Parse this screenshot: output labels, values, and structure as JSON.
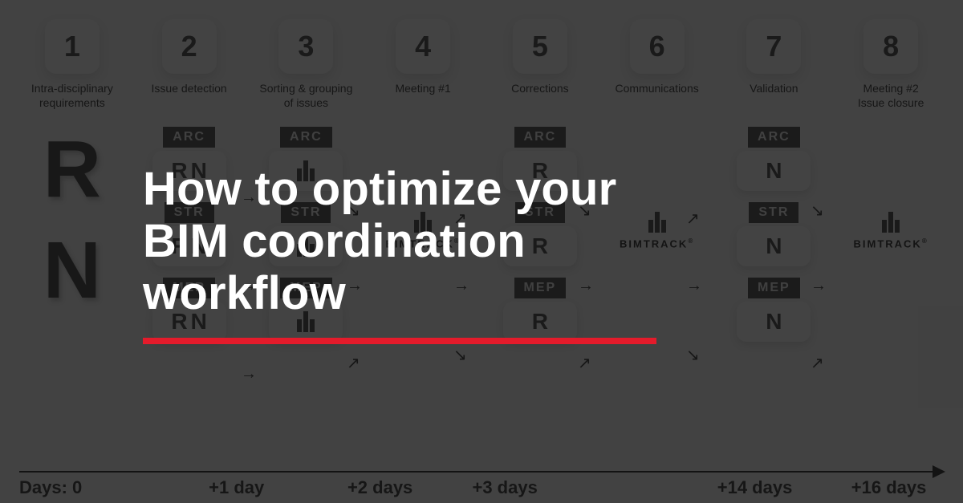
{
  "headline": "How to optimize your\nBIM coordination\nworkflow",
  "accent_color": "#e41b2b",
  "brand": "BIMTRACK",
  "steps": [
    {
      "n": "1",
      "label": "Intra-disciplinary\nrequirements"
    },
    {
      "n": "2",
      "label": "Issue detection"
    },
    {
      "n": "3",
      "label": "Sorting & grouping\nof issues"
    },
    {
      "n": "4",
      "label": "Meeting #1"
    },
    {
      "n": "5",
      "label": "Corrections"
    },
    {
      "n": "6",
      "label": "Communications"
    },
    {
      "n": "7",
      "label": "Validation"
    },
    {
      "n": "8",
      "label": "Meeting #2\nIssue closure"
    }
  ],
  "disciplines": [
    "ARC",
    "STR",
    "MEP"
  ],
  "icons": {
    "R_letter": "R",
    "N_letter": "N"
  },
  "timeline": {
    "axis_label": "Days:",
    "ticks": [
      {
        "pos": 0.0,
        "text": "Days: 0"
      },
      {
        "pos": 0.205,
        "text": "+1 day"
      },
      {
        "pos": 0.355,
        "text": "+2 days"
      },
      {
        "pos": 0.49,
        "text": "+3 days"
      },
      {
        "pos": 0.755,
        "text": "+14 days"
      },
      {
        "pos": 0.9,
        "text": "+16 days"
      }
    ]
  }
}
